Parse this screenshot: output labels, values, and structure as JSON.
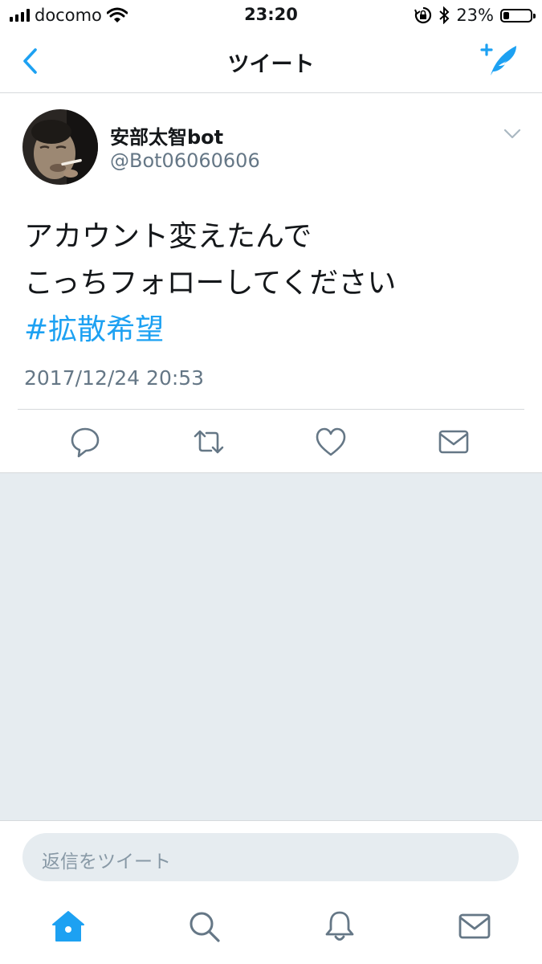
{
  "status_bar": {
    "carrier": "docomo",
    "time": "23:20",
    "battery_percent": "23%",
    "battery_level": 0.23,
    "icons": [
      "signal-icon",
      "wifi-icon",
      "orientation-lock-icon",
      "bluetooth-icon",
      "battery-icon"
    ]
  },
  "nav": {
    "title": "ツイート",
    "icons": [
      "back-chevron-icon",
      "compose-tweet-icon"
    ]
  },
  "tweet": {
    "display_name": "安部太智bot",
    "handle": "@Bot06060606",
    "text_line1": "アカウント変えたんで",
    "text_line2": "こっちフォローしてください",
    "hashtag": "#拡散希望",
    "timestamp": "2017/12/24 20:53",
    "actions": [
      "reply-icon",
      "retweet-icon",
      "like-icon",
      "direct-message-icon"
    ]
  },
  "reply": {
    "placeholder": "返信をツイート"
  },
  "tab_bar": {
    "tabs": [
      "home-icon",
      "search-icon",
      "notifications-icon",
      "messages-icon"
    ],
    "active": "home-icon"
  },
  "colors": {
    "accent": "#1da1f2",
    "text_primary": "#14171a",
    "text_secondary": "#657786",
    "background_gray": "#e6ecf0",
    "inactive_icon": "#657786"
  }
}
